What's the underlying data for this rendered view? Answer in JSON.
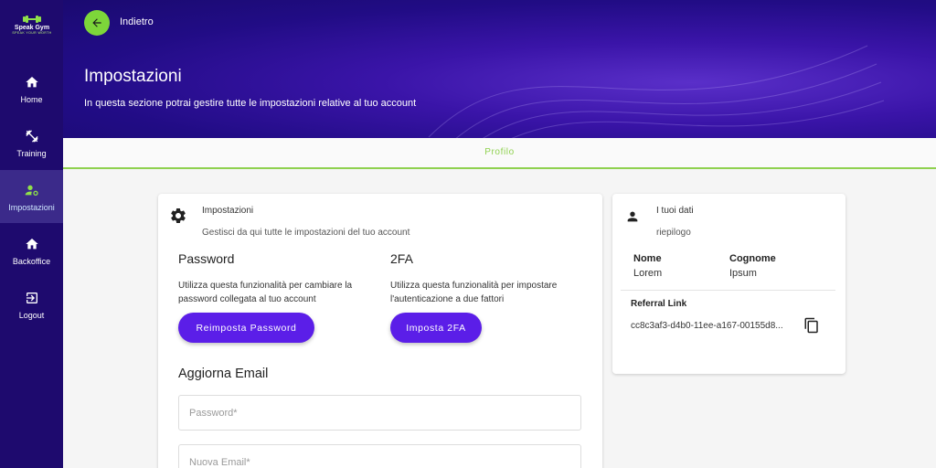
{
  "brand": {
    "name": "Speak Gym",
    "tagline": "SPEAK YOUR WORTH"
  },
  "sidebar": {
    "items": [
      {
        "label": "Home",
        "icon": "home-icon"
      },
      {
        "label": "Training",
        "icon": "training-icon"
      },
      {
        "label": "Impostazioni",
        "icon": "settings-users-icon"
      },
      {
        "label": "Backoffice",
        "icon": "home-icon"
      },
      {
        "label": "Logout",
        "icon": "logout-icon"
      }
    ],
    "active": "Impostazioni"
  },
  "header": {
    "back_label": "Indietro",
    "title": "Impostazioni",
    "subtitle": "In questa sezione potrai gestire tutte le impostazioni relative al tuo account"
  },
  "tabs": [
    {
      "label": "Profilo"
    }
  ],
  "settings_card": {
    "title": "Impostazioni",
    "subtitle": "Gestisci da qui tutte le impostazioni del tuo account",
    "password": {
      "title": "Password",
      "description": "Utilizza questa funzionalità per cambiare la password collegata al tuo account",
      "button": "Reimposta Password"
    },
    "twofa": {
      "title": "2FA",
      "description": "Utilizza questa funzionalità per impostare l'autenticazione a due fattori",
      "button": "Imposta 2FA"
    },
    "email": {
      "title": "Aggiorna Email",
      "password_placeholder": "Password*",
      "new_email_placeholder": "Nuova Email*"
    }
  },
  "data_card": {
    "title": "I tuoi dati",
    "subtitle": "riepilogo",
    "nome_label": "Nome",
    "nome_value": "Lorem",
    "cognome_label": "Cognome",
    "cognome_value": "Ipsum",
    "referral_title": "Referral Link",
    "referral_value": "cc8c3af3-d4b0-11ee-a167-00155d8..."
  },
  "colors": {
    "accent_green": "#8fd14f",
    "primary_purple": "#5b1ee8",
    "sidebar_bg": "#1e0a6e"
  }
}
